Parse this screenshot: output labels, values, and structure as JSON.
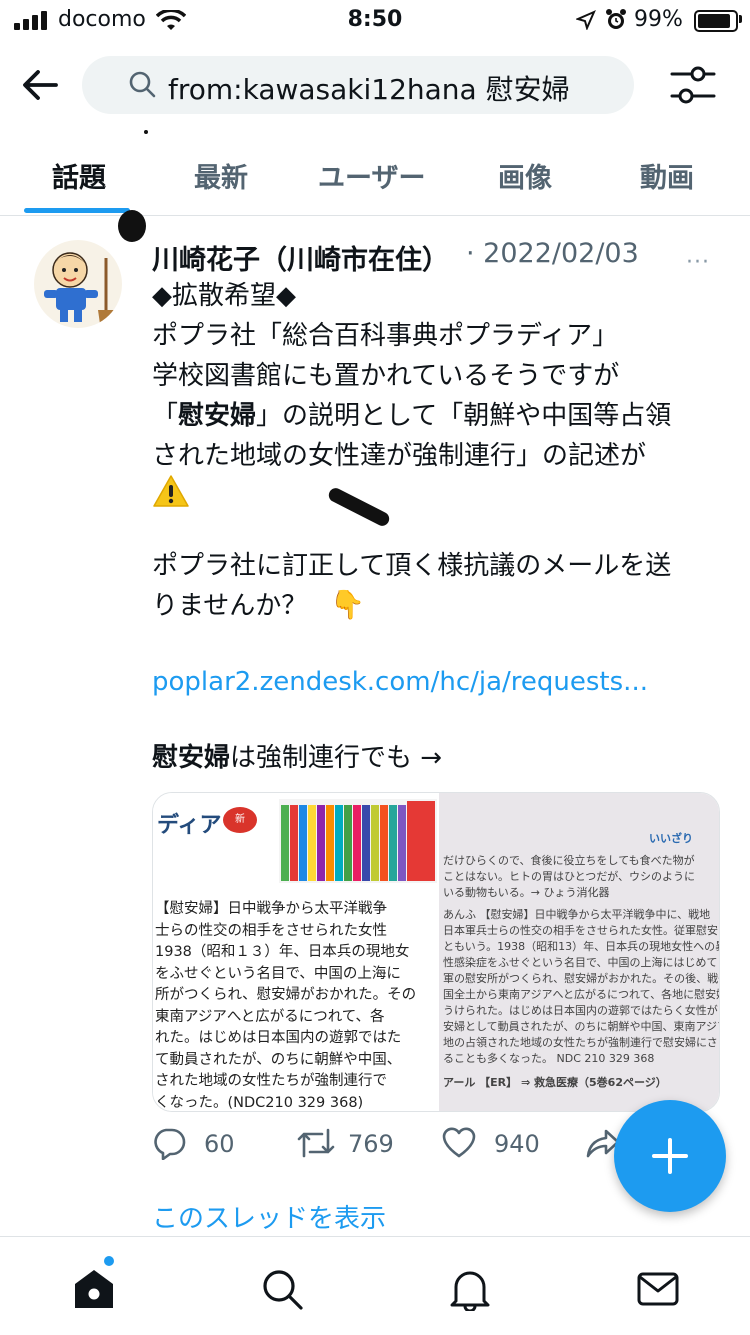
{
  "status_bar": {
    "carrier": "docomo",
    "time": "8:50",
    "battery": "99%"
  },
  "header": {
    "search_query": "from:kawasaki12hana 慰安婦"
  },
  "tabs": [
    {
      "label": "話題",
      "active": true
    },
    {
      "label": "最新",
      "active": false
    },
    {
      "label": "ユーザー",
      "active": false
    },
    {
      "label": "画像",
      "active": false
    },
    {
      "label": "動画",
      "active": false
    }
  ],
  "tweet": {
    "author": "川崎花子（川崎市在住）",
    "date": "· 2022/02/03",
    "more": "···",
    "lines": [
      "◆拡散希望◆",
      "ポプラ社「総合百科事典ポプラディア」",
      "学校図書館にも置かれているそうですが",
      "」の説明として「朝鮮や中国等占領",
      "された地域の女性達が強制連行」の記述が"
    ],
    "line4_open": "「",
    "line4_bold": "慰安婦",
    "warning_emoji": "⚠️",
    "line6": "ポプラ社に訂正して頂く様抗議のメールを送",
    "line7": "りませんか？",
    "point_emoji": "👇",
    "link": "poplar2.zendesk.com/hc/ja/requests...",
    "quote_bold": "慰安婦",
    "quote_rest": "は強制連行でも →",
    "media": {
      "left_title": "ディア",
      "left_badge": "新",
      "left_lines": [
        "【慰安婦】日中戦争から太平洋戦争",
        "士らの性交の相手をさせられた女性",
        "1938（昭和１３）年、日本兵の現地女",
        "をふせぐという名目で、中国の上海に",
        "所がつくられ、慰安婦がおかれた。その",
        "東南アジアへと広がるにつれて、各",
        "れた。はじめは日本国内の遊郭ではた",
        "て動員されたが、のちに朝鮮や中国、",
        "された地域の女性たちが強制連行で",
        "くなった。(NDC210 329 368)"
      ],
      "right_lines": [
        "いいざり",
        "だけひらくので、食後に役立ちをしても食べた物が",
        "ことはない。ヒトの胃はひとつだが、ウシのように",
        "いる動物もいる。→ ひょう消化器",
        "あんふ 【慰安婦】日中戦争から太平洋戦争中に、戦地",
        "日本軍兵士らの性交の相手をさせられた女性。従軍慰安",
        "ともいう。1938（昭和13）年、日本兵の現地女性への暴行",
        "性感染症をふせぐという名目で、中国の上海にはじめて日",
        "軍の慰安所がつくられ、慰安婦がおかれた。その後、戦争",
        "国全土から東南アジアへと広がるにつれて、各地に慰安婦",
        "うけられた。はじめは日本国内の遊郭ではたらく女性が",
        "安婦として動員されたが、のちに朝鮮や中国、東南アジア",
        "地の占領された地域の女性たちが強制連行で慰安婦にさ",
        "ることも多くなった。 NDC 210 329 368",
        "アール 【ER】 ⇒ 救急医療（5巻62ページ）"
      ]
    },
    "actions": {
      "replies": "60",
      "retweets": "769",
      "likes": "940"
    },
    "show_thread": "このスレッドを表示"
  }
}
